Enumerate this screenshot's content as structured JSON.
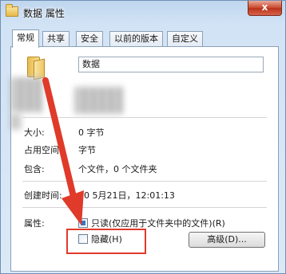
{
  "window": {
    "title": "数据 属性",
    "close_label": "x"
  },
  "tabs": [
    {
      "label": "常规",
      "active": true
    },
    {
      "label": "共享",
      "active": false
    },
    {
      "label": "安全",
      "active": false
    },
    {
      "label": "以前的版本",
      "active": false
    },
    {
      "label": "自定义",
      "active": false
    }
  ],
  "general": {
    "folder_name": "数据",
    "size_label": "大小:",
    "size_value": "0 字节",
    "disk_size_label": "占用空间:",
    "disk_size_value": "字节",
    "contains_label": "包含:",
    "contains_value": "个文件，0 个文件夹",
    "created_label": "创建时间:",
    "created_value": "20 5月21日，12:01:13",
    "attributes_label": "属性:",
    "readonly_label": "只读(仅应用于文件夹中的文件)(R)",
    "hidden_label": "隐藏(H)",
    "advanced_label": "高级(D)..."
  },
  "annotation": {
    "arrow_color": "#e03a2a",
    "box_color": "#e03a2a"
  }
}
